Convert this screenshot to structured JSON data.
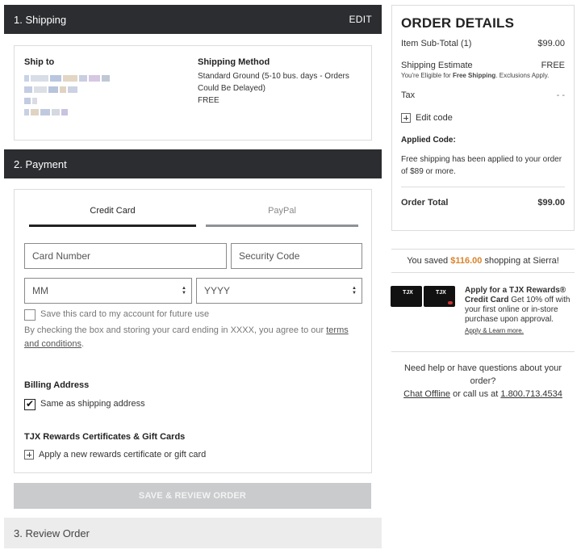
{
  "sections": {
    "shipping": {
      "title": "1. Shipping",
      "edit": "EDIT"
    },
    "payment": {
      "title": "2. Payment"
    },
    "review": {
      "title": "3. Review Order"
    }
  },
  "shipping": {
    "ship_to_label": "Ship to",
    "method_label": "Shipping Method",
    "method_text": "Standard Ground (5-10 bus. days - Orders Could Be Delayed)",
    "method_price": "FREE"
  },
  "payment": {
    "tabs": [
      {
        "label": "Credit Card"
      },
      {
        "label": "PayPal"
      }
    ],
    "card_number_placeholder": "Card Number",
    "security_code_placeholder": "Security Code",
    "month_value": "MM",
    "year_value": "YYYY",
    "save_card_label": "Save this card to my account for future use",
    "agree_text": "By checking the box and storing your card ending in XXXX, you agree to our ",
    "terms_link": "terms and conditions",
    "agree_end": ".",
    "billing_label": "Billing Address",
    "same_as_shipping": "Same as shipping address",
    "rewards_label": "TJX Rewards Certificates & Gift Cards",
    "apply_rewards": "Apply a new rewards certificate or gift card",
    "apply_icon": "plus-square-icon",
    "save_button": "SAVE & REVIEW ORDER"
  },
  "order": {
    "title": "ORDER DETAILS",
    "subtotal_label": "Item Sub-Total (1)",
    "subtotal_value": "$99.00",
    "shipping_label": "Shipping Estimate",
    "shipping_value": "FREE",
    "shipping_note_pre": "You're Eligible for ",
    "shipping_note_bold": "Free Shipping",
    "shipping_note_post": ". Exclusions Apply.",
    "tax_label": "Tax",
    "tax_value": "- -",
    "edit_code": "Edit code",
    "applied_code_label": "Applied Code:",
    "applied_code_text": "Free shipping has been applied to your order of $89 or more.",
    "total_label": "Order Total",
    "total_value": "$99.00"
  },
  "savings": {
    "pre": "You saved ",
    "amount": "$116.00",
    "post": " shopping at Sierra!"
  },
  "promo": {
    "card_logo": "TJX",
    "bold": "Apply for a TJX Rewards® Credit Card",
    "text": " Get 10% off with your first online or in-store purchase upon approval.",
    "link": "Apply & Learn more."
  },
  "help": {
    "question": "Need help or have questions about your order?",
    "chat": "Chat Offline",
    "middle": " or call us at ",
    "phone": "1.800.713.4534"
  },
  "colors": {
    "dark_header": "#2b2d30",
    "accent": "#d9822b",
    "button_disabled": "#c9cbcd"
  }
}
